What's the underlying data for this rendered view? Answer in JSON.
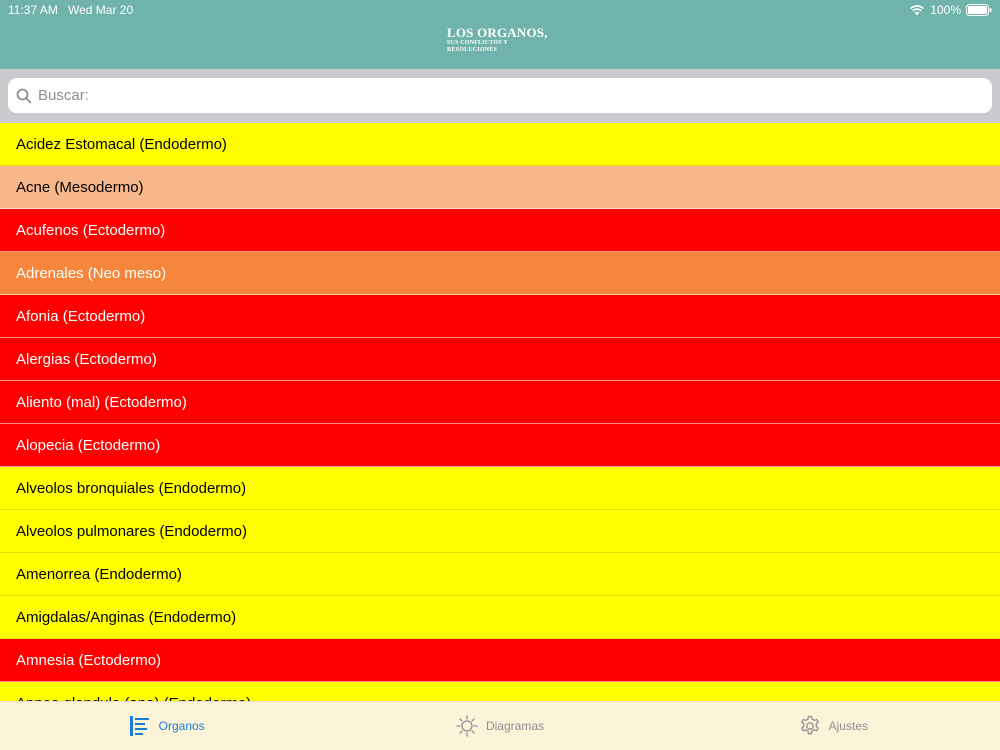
{
  "status": {
    "time": "11:37 AM",
    "date": "Wed Mar 20",
    "battery": "100%"
  },
  "header": {
    "logo_line1": "LOS ORGANOS,",
    "logo_line2": "SUS CONFLICTOS Y",
    "logo_line3": "RESOLUCIONES"
  },
  "search": {
    "placeholder": "Buscar:",
    "value": ""
  },
  "list": [
    {
      "label": "Acidez Estomacal (Endodermo)",
      "layer": "endodermo"
    },
    {
      "label": "Acne (Mesodermo)",
      "layer": "mesodermo"
    },
    {
      "label": "Acufenos (Ectodermo)",
      "layer": "ectodermo"
    },
    {
      "label": "Adrenales (Neo meso)",
      "layer": "neomeso"
    },
    {
      "label": "Afonia (Ectodermo)",
      "layer": "ectodermo"
    },
    {
      "label": "Alergias (Ectodermo)",
      "layer": "ectodermo"
    },
    {
      "label": "Aliento (mal)  (Ectodermo)",
      "layer": "ectodermo"
    },
    {
      "label": "Alopecia  (Ectodermo)",
      "layer": "ectodermo"
    },
    {
      "label": "Alveolos bronquiales (Endodermo)",
      "layer": "endodermo"
    },
    {
      "label": "Alveolos pulmonares (Endodermo)",
      "layer": "endodermo"
    },
    {
      "label": "Amenorrea (Endodermo)",
      "layer": "endodermo"
    },
    {
      "label": "Amigdalas/Anginas  (Endodermo)",
      "layer": "endodermo"
    },
    {
      "label": "Amnesia (Ectodermo)",
      "layer": "ectodermo"
    },
    {
      "label": "Apnea glandula (ana) (Endodermo)",
      "layer": "endodermo"
    }
  ],
  "colors": {
    "header_bg": "#6fb3ac",
    "endodermo": "#ffff00",
    "mesodermo": "#f8b78a",
    "ectodermo": "#ff0000",
    "neomeso": "#f5863b",
    "tab_active": "#1a7bd8",
    "tab_inactive": "#8e8e93",
    "tabbar_bg": "#fbf4d9"
  },
  "tabs": [
    {
      "label": "Organos",
      "icon": "list-icon",
      "active": true
    },
    {
      "label": "Diagramas",
      "icon": "sun-icon",
      "active": false
    },
    {
      "label": "Ajustes",
      "icon": "gear-icon",
      "active": false
    }
  ]
}
